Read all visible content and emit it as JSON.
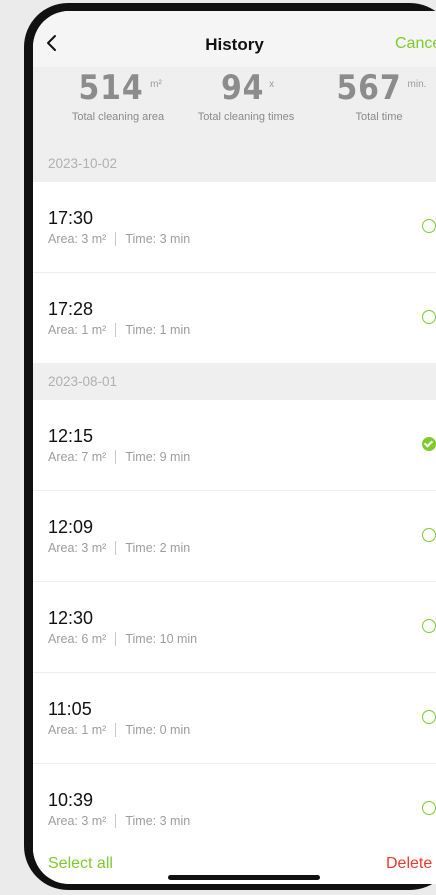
{
  "header": {
    "title": "History",
    "cancel_label": "Cancel"
  },
  "stats": [
    {
      "value": "514",
      "unit": "m²",
      "label": "Total cleaning area"
    },
    {
      "value": "94",
      "unit": "x",
      "label": "Total cleaning times"
    },
    {
      "value": "567",
      "unit": "min.",
      "label": "Total time"
    }
  ],
  "groups": [
    {
      "date": "2023-10-02",
      "items": [
        {
          "time": "17:30",
          "area": "Area: 3 m²",
          "duration": "Time: 3 min",
          "selected": false
        },
        {
          "time": "17:28",
          "area": "Area: 1 m²",
          "duration": "Time: 1 min",
          "selected": false
        }
      ]
    },
    {
      "date": "2023-08-01",
      "items": [
        {
          "time": "12:15",
          "area": "Area: 7 m²",
          "duration": "Time: 9 min",
          "selected": true
        },
        {
          "time": "12:09",
          "area": "Area: 3 m²",
          "duration": "Time: 2 min",
          "selected": false
        },
        {
          "time": "12:30",
          "area": "Area: 6 m²",
          "duration": "Time: 10 min",
          "selected": false
        },
        {
          "time": "11:05",
          "area": "Area: 1 m²",
          "duration": "Time: 0 min",
          "selected": false
        },
        {
          "time": "10:39",
          "area": "Area: 3 m²",
          "duration": "Time: 3 min",
          "selected": false
        }
      ]
    }
  ],
  "footer": {
    "select_all_label": "Select all",
    "delete_label": "Delete"
  },
  "colors": {
    "accent": "#7ecb2c",
    "danger": "#e83b2f"
  }
}
